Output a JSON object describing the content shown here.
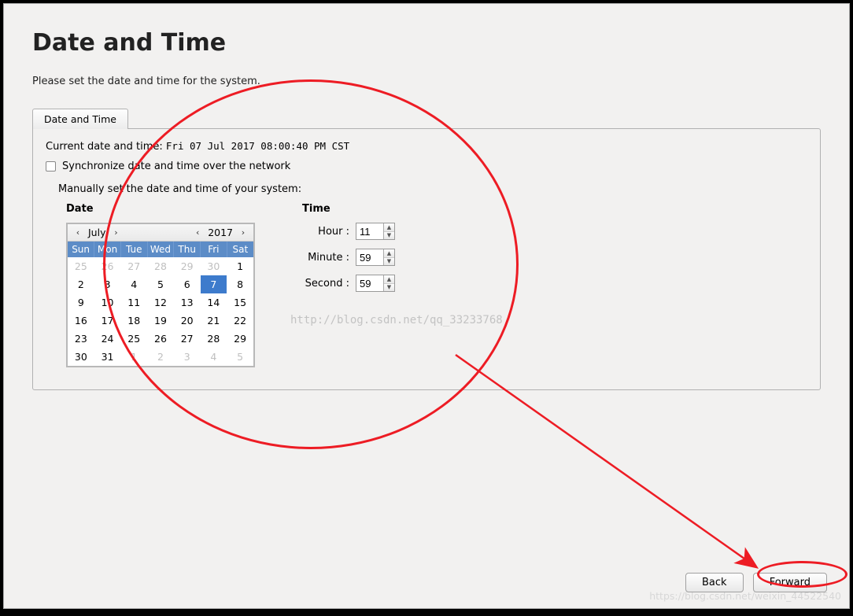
{
  "title": "Date and Time",
  "instruction": "Please set the date and time for the system.",
  "tab_label": "Date and Time",
  "current_label": "Current date and time:",
  "current_value": "Fri 07 Jul 2017 08:00:40 PM CST",
  "sync_label": "Synchronize date and time over the network",
  "manual_label": "Manually set the date and time of your system:",
  "date_label": "Date",
  "time_label": "Time",
  "month": "July",
  "year": "2017",
  "weekdays": [
    "Sun",
    "Mon",
    "Tue",
    "Wed",
    "Thu",
    "Fri",
    "Sat"
  ],
  "weeks": [
    [
      {
        "d": "25",
        "out": true
      },
      {
        "d": "26",
        "out": true
      },
      {
        "d": "27",
        "out": true
      },
      {
        "d": "28",
        "out": true
      },
      {
        "d": "29",
        "out": true
      },
      {
        "d": "30",
        "out": true
      },
      {
        "d": "1"
      }
    ],
    [
      {
        "d": "2"
      },
      {
        "d": "3"
      },
      {
        "d": "4"
      },
      {
        "d": "5"
      },
      {
        "d": "6"
      },
      {
        "d": "7",
        "sel": true
      },
      {
        "d": "8"
      }
    ],
    [
      {
        "d": "9"
      },
      {
        "d": "10"
      },
      {
        "d": "11"
      },
      {
        "d": "12"
      },
      {
        "d": "13"
      },
      {
        "d": "14"
      },
      {
        "d": "15"
      }
    ],
    [
      {
        "d": "16"
      },
      {
        "d": "17"
      },
      {
        "d": "18"
      },
      {
        "d": "19"
      },
      {
        "d": "20"
      },
      {
        "d": "21"
      },
      {
        "d": "22"
      }
    ],
    [
      {
        "d": "23"
      },
      {
        "d": "24"
      },
      {
        "d": "25"
      },
      {
        "d": "26"
      },
      {
        "d": "27"
      },
      {
        "d": "28"
      },
      {
        "d": "29"
      }
    ],
    [
      {
        "d": "30"
      },
      {
        "d": "31"
      },
      {
        "d": "1",
        "out": true
      },
      {
        "d": "2",
        "out": true
      },
      {
        "d": "3",
        "out": true
      },
      {
        "d": "4",
        "out": true
      },
      {
        "d": "5",
        "out": true
      }
    ]
  ],
  "hour_label": "Hour :",
  "minute_label": "Minute :",
  "second_label": "Second :",
  "hour": "11",
  "minute": "59",
  "second": "59",
  "back_label": "Back",
  "forward_label": "Forward",
  "watermark1": "http://blog.csdn.net/qq_33233768",
  "watermark2": "https://blog.csdn.net/weixin_44522540",
  "annotation_color": "#ed1c24"
}
